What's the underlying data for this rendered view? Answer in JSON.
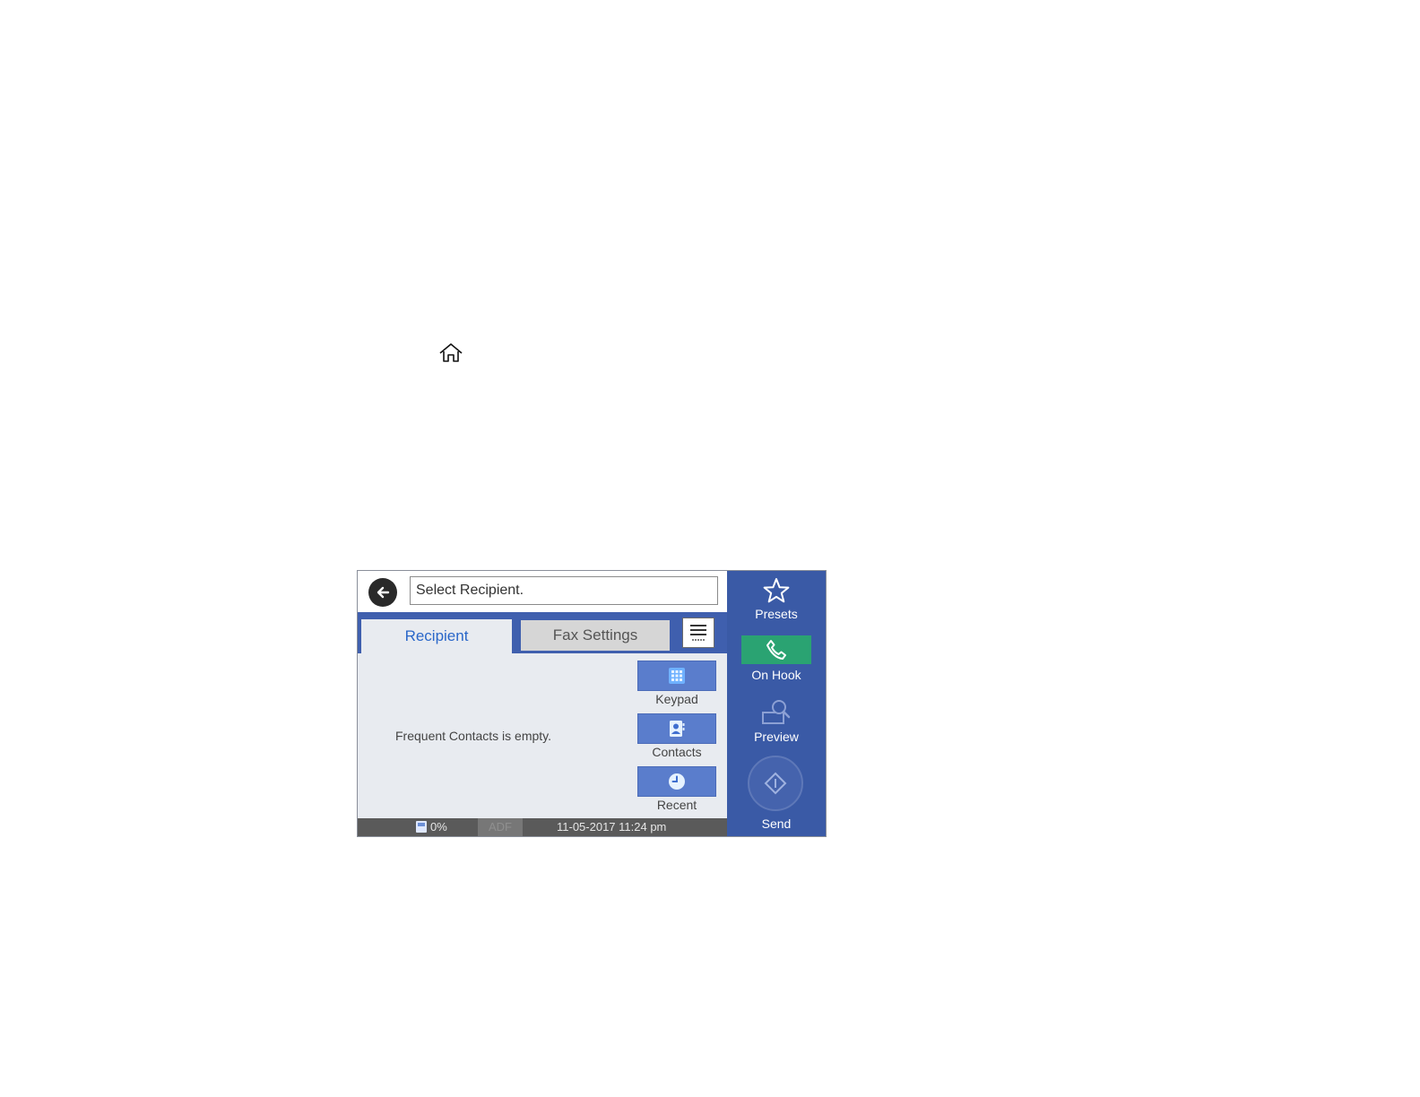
{
  "instruction_icon": "home-icon",
  "header": {
    "back_icon": "arrow-left-icon",
    "recipient_field": "Select Recipient."
  },
  "tabs": [
    {
      "label": "Recipient",
      "active": true
    },
    {
      "label": "Fax Settings",
      "active": false
    }
  ],
  "menu_icon": "list-menu-icon",
  "content": {
    "empty_message": "Frequent Contacts is empty."
  },
  "side_buttons": [
    {
      "label": "Keypad",
      "icon": "keypad-icon"
    },
    {
      "label": "Contacts",
      "icon": "contacts-icon"
    },
    {
      "label": "Recent",
      "icon": "clock-icon"
    }
  ],
  "status": {
    "memory": "0%",
    "memory_icon": "memory-icon",
    "adf": "ADF",
    "datetime": "11-05-2017 11:24 pm"
  },
  "rightbar": {
    "presets": "Presets",
    "on_hook": "On Hook",
    "preview": "Preview",
    "send": "Send"
  },
  "colors": {
    "tab_bar": "#3f5fae",
    "right_bar": "#3a5aa6",
    "on_hook": "#2aa372",
    "side_button": "#5a7dcc",
    "active_tab_text": "#2a67c9"
  }
}
